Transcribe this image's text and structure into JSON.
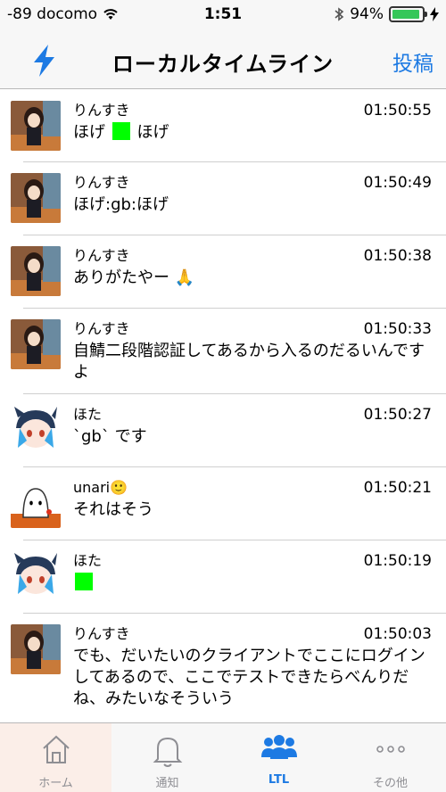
{
  "status_bar": {
    "carrier": "-89 docomo",
    "time": "1:51",
    "battery": "94%",
    "battery_level": 0.94
  },
  "nav": {
    "title": "ローカルタイムライン",
    "post_button": "投稿"
  },
  "posts": [
    {
      "user": "りんすき",
      "time": "01:50:55",
      "text_a": "ほげ",
      "text_b": "ほげ"
    },
    {
      "user": "りんすき",
      "time": "01:50:49",
      "text": "ほげ:gb:ほげ"
    },
    {
      "user": "りんすき",
      "time": "01:50:38",
      "text": "ありがたやー 🙏"
    },
    {
      "user": "りんすき",
      "time": "01:50:33",
      "text": "自鯖二段階認証してあるから入るのだるいんですよ"
    },
    {
      "user": "ほた",
      "time": "01:50:27",
      "text": "`gb` です"
    },
    {
      "user": "unari🙂",
      "time": "01:50:21",
      "text": "それはそう"
    },
    {
      "user": "ほた",
      "time": "01:50:19"
    },
    {
      "user": "りんすき",
      "time": "01:50:03",
      "text": "でも、だいたいのクライアントでここにログインしてあるので、ここでテストできたらべんりだね、みたいなそういう"
    }
  ],
  "tabs": [
    {
      "label": "ホーム",
      "icon": "home-icon"
    },
    {
      "label": "通知",
      "icon": "bell-icon"
    },
    {
      "label": "LTL",
      "icon": "people-icon"
    },
    {
      "label": "その他",
      "icon": "more-icon"
    }
  ],
  "colors": {
    "accent": "#1d7ae3",
    "emoji_square": "#00ff00",
    "battery": "#35c759"
  }
}
